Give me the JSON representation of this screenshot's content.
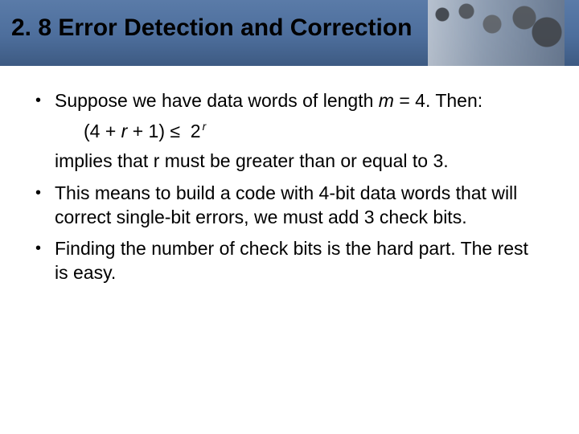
{
  "title": "2. 8 Error Detection and Correction",
  "bullets": {
    "b1_pre": "Suppose we have data words of length ",
    "b1_m": "m",
    "b1_post": " = 4. Then:",
    "formula_pre": "(4 + ",
    "formula_r1": "r",
    "formula_mid1": " + 1) ",
    "formula_le": "≤",
    "formula_mid2": "  2",
    "formula_r2": "r",
    "cont1": "implies that r must be greater than or equal to 3.",
    "b2": "This means to build a code with 4-bit data words that will correct single-bit errors, we must add 3 check bits.",
    "b3": "Finding the number of check bits is the hard part. The rest is easy."
  }
}
